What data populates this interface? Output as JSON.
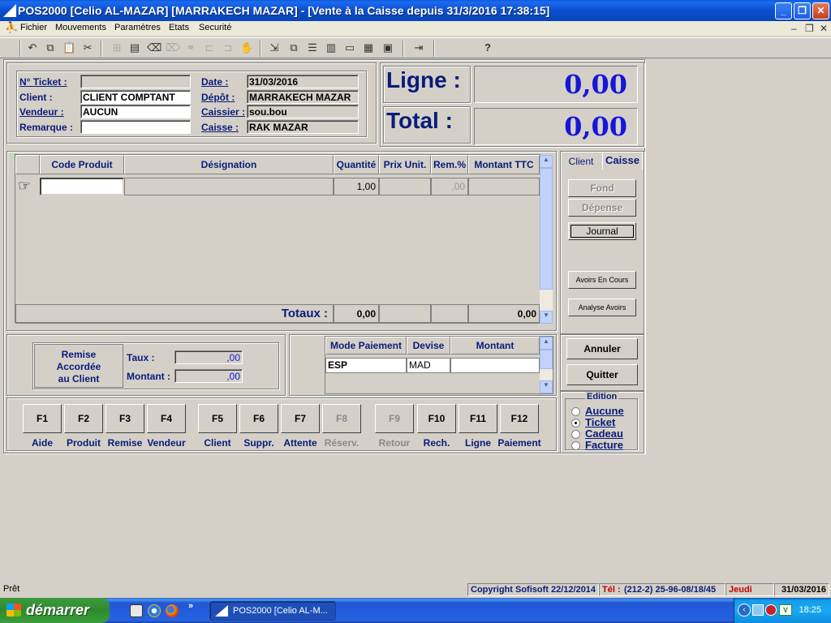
{
  "window": {
    "title": "POS2000 [Celio AL-MAZAR] [MARRAKECH MAZAR] - [Vente à la Caisse depuis 31/3/2016 17:38:15]",
    "controls": {
      "minimize": "_",
      "maximize": "❐",
      "close": "✕"
    }
  },
  "menu": {
    "items": [
      "Fichier",
      "Mouvements",
      "Paramètres",
      "Etats",
      "Securité"
    ],
    "mdi": {
      "minimize": "–",
      "restore": "❐",
      "close": "✕"
    }
  },
  "toolbar": {
    "icons": [
      "undo-icon",
      "copy-icon",
      "paste-icon",
      "cut-icon",
      "insert-row-icon",
      "delete-row-icon",
      "eraser-icon",
      "clear-icon",
      "link-icon",
      "link2-icon",
      "link3-icon",
      "hand-icon",
      "export-icon",
      "tile-icon",
      "rows-icon",
      "cols-icon",
      "window-icon",
      "grid-icon",
      "calc-icon",
      "exit-icon",
      "help-icon"
    ],
    "glyphs": [
      "↶",
      "⧉",
      "📋",
      "✂",
      "⊞",
      "▤",
      "⌫",
      "⌦",
      "⚭",
      "⊏",
      "⊐",
      "✋",
      "⇲",
      "⧉",
      "☰",
      "▥",
      "▭",
      "▦",
      "▣",
      "⇥",
      "?"
    ]
  },
  "ticket": {
    "ticket_label": "N° Ticket :",
    "ticket_value": "",
    "client_label": "Client :",
    "client_value": "CLIENT COMPTANT",
    "vendeur_label": "Vendeur :",
    "vendeur_value": "AUCUN",
    "remarque_label": "Remarque :",
    "remarque_value": "",
    "date_label": "Date :",
    "date_value": "31/03/2016",
    "depot_label": "Dépôt :",
    "depot_value": "MARRAKECH MAZAR",
    "caissier_label": "Caissier :",
    "caissier_value": "sou.bou",
    "caisse_label": "Caisse :",
    "caisse_value": "RAK MAZAR"
  },
  "display": {
    "ligne_label": "Ligne :",
    "ligne_value": "0,00",
    "total_label": "Total  :",
    "total_value": "0,00"
  },
  "grid": {
    "headers": [
      "Code Produit",
      "Désignation",
      "Quantité",
      "Prix Unit.",
      "Rem.%",
      "Montant TTC"
    ],
    "row": {
      "code": "",
      "designation": "",
      "quantite": "1,00",
      "prix": "",
      "remise": ",00",
      "montant": ""
    },
    "totaux_label": "Totaux :",
    "totaux": {
      "quantite": "0,00",
      "prix": "",
      "remise": "",
      "montant": "0,00"
    }
  },
  "side_tabs": [
    "Client",
    "Caisse"
  ],
  "side_buttons": {
    "fond": "Fond",
    "depense": "Dépense",
    "journal": "Journal",
    "avoirs_en_cours": "Avoirs En Cours",
    "analyse_avoirs": "Analyse Avoirs"
  },
  "remise": {
    "title": "Remise\nAccordée\nau Client",
    "taux_label": "Taux :",
    "taux_value": ",00",
    "montant_label": "Montant :",
    "montant_value": ",00"
  },
  "payment": {
    "headers": [
      "Mode Paiement",
      "Devise",
      "Montant"
    ],
    "row": {
      "mode": "ESP",
      "devise": "MAD",
      "montant": ""
    }
  },
  "actions": {
    "annuler": "Annuler",
    "quitter": "Quitter"
  },
  "fkeys": [
    {
      "key": "F1",
      "label": "Aide",
      "enabled": true
    },
    {
      "key": "F2",
      "label": "Produit",
      "enabled": true
    },
    {
      "key": "F3",
      "label": "Remise",
      "enabled": true
    },
    {
      "key": "F4",
      "label": "Vendeur",
      "enabled": true
    },
    {
      "key": "F5",
      "label": "Client",
      "enabled": true
    },
    {
      "key": "F6",
      "label": "Suppr.",
      "enabled": true
    },
    {
      "key": "F7",
      "label": "Attente",
      "enabled": true
    },
    {
      "key": "F8",
      "label": "Réserv.",
      "enabled": false
    },
    {
      "key": "F9",
      "label": "Retour",
      "enabled": false
    },
    {
      "key": "F10",
      "label": "Rech.",
      "enabled": true
    },
    {
      "key": "F11",
      "label": "Ligne",
      "enabled": true
    },
    {
      "key": "F12",
      "label": "Paiement",
      "enabled": true
    }
  ],
  "edition": {
    "title": "Edition",
    "options": [
      {
        "label": "Aucune",
        "selected": false
      },
      {
        "label": "Ticket",
        "selected": true
      },
      {
        "label": "Cadeau",
        "selected": false
      },
      {
        "label": "Facture",
        "selected": false
      }
    ]
  },
  "status": {
    "text": "Prêt",
    "copyright": "Copyright Sofisoft 22/12/2014",
    "tel_label": "Tél :",
    "tel": "(212-2) 25-96-08/18/45",
    "day": "Jeudi",
    "date": "31/03/2016"
  },
  "taskbar": {
    "start": "démarrer",
    "task": "POS2000 [Celio AL-M...",
    "clock": "18:25",
    "chevron": "»"
  },
  "colors": {
    "label_blue": "#0a1b7a",
    "amount_blue": "#1616d8",
    "face": "#d4d0c8"
  }
}
